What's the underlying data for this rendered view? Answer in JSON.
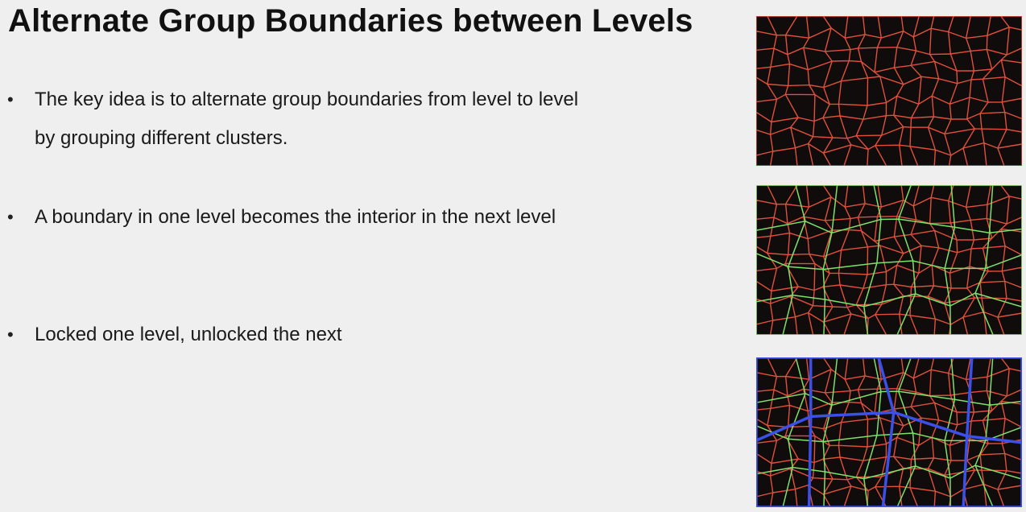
{
  "slide": {
    "title": "Alternate Group Boundaries between Levels",
    "bullets": [
      {
        "symbol": "•",
        "text": "The key idea is to alternate group boundaries from level to level by grouping different clusters."
      },
      {
        "symbol": "•",
        "text": "A boundary in one level becomes the interior in the next level"
      },
      {
        "symbol": "•",
        "text": "Locked one level, unlocked the next"
      }
    ]
  },
  "figures": {
    "colors": {
      "background": "#100c0b",
      "cluster_edges": "#e0503c",
      "group_boundaries_level1": "#7ee06a",
      "group_boundaries_level2": "#3a50e8"
    },
    "panels": [
      {
        "name": "clusters",
        "layers": [
          "cluster_edges"
        ]
      },
      {
        "name": "level-1-groups",
        "layers": [
          "cluster_edges",
          "group_boundaries_level1"
        ]
      },
      {
        "name": "level-2-groups",
        "layers": [
          "cluster_edges",
          "group_boundaries_level1",
          "group_boundaries_level2"
        ]
      }
    ]
  }
}
